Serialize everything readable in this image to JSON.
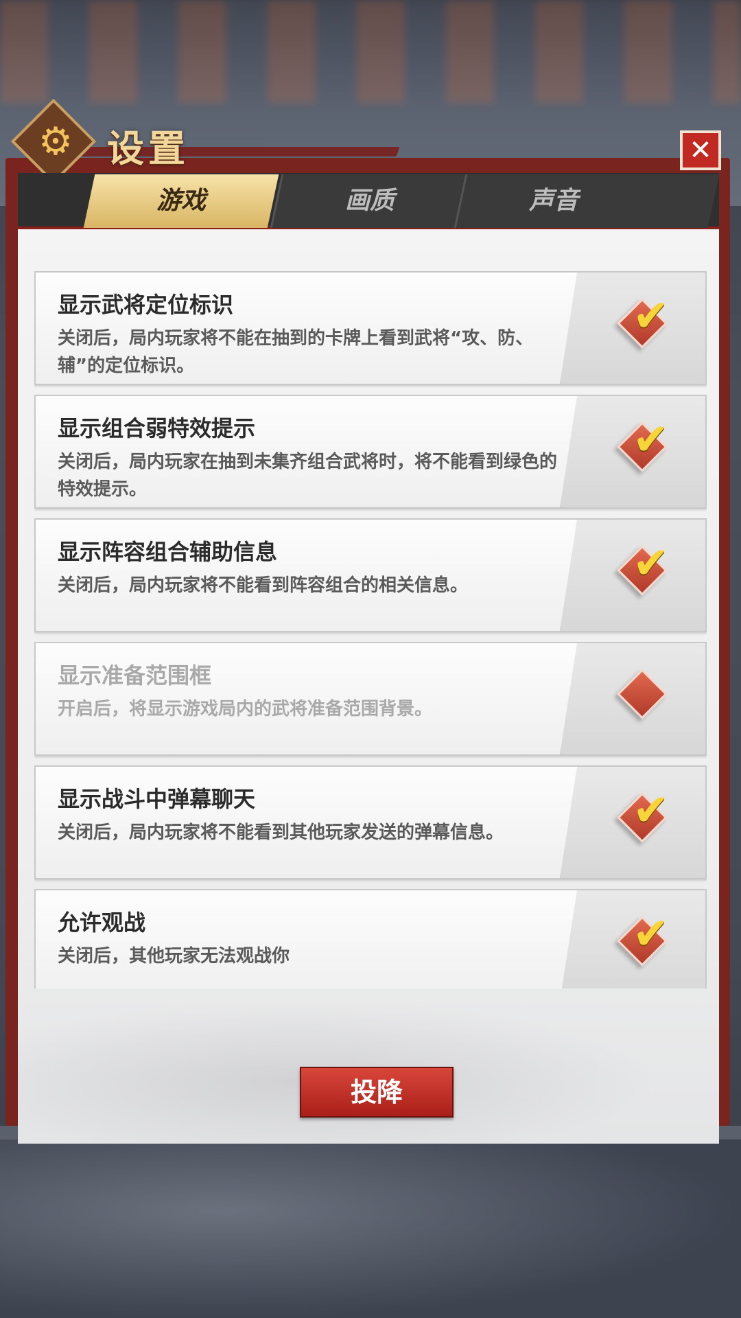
{
  "header": {
    "title": "设置",
    "close_label": "✕",
    "gear_glyph": "⚙"
  },
  "tabs": [
    {
      "label": "游戏",
      "active": true
    },
    {
      "label": "画质",
      "active": false
    },
    {
      "label": "声音",
      "active": false
    }
  ],
  "settings": [
    {
      "title": "显示武将定位标识",
      "desc": "关闭后，局内玩家将不能在抽到的卡牌上看到武将“攻、防、辅”的定位标识。",
      "checked": true,
      "disabled": false
    },
    {
      "title": "显示组合弱特效提示",
      "desc": "关闭后，局内玩家在抽到未集齐组合武将时，将不能看到绿色的特效提示。",
      "checked": true,
      "disabled": false
    },
    {
      "title": "显示阵容组合辅助信息",
      "desc": "关闭后，局内玩家将不能看到阵容组合的相关信息。",
      "checked": true,
      "disabled": false
    },
    {
      "title": "显示准备范围框",
      "desc": "开启后，将显示游戏局内的武将准备范围背景。",
      "checked": false,
      "disabled": true
    },
    {
      "title": "显示战斗中弹幕聊天",
      "desc": "关闭后，局内玩家将不能看到其他玩家发送的弹幕信息。",
      "checked": true,
      "disabled": false
    },
    {
      "title": "允许观战",
      "desc": "关闭后，其他玩家无法观战你",
      "checked": true,
      "disabled": false
    }
  ],
  "surrender_label": "投降",
  "check_glyph": "✔",
  "colors": {
    "accent_red": "#c12a22",
    "tab_active": "#d9b664",
    "check_yellow": "#f6d43a"
  }
}
